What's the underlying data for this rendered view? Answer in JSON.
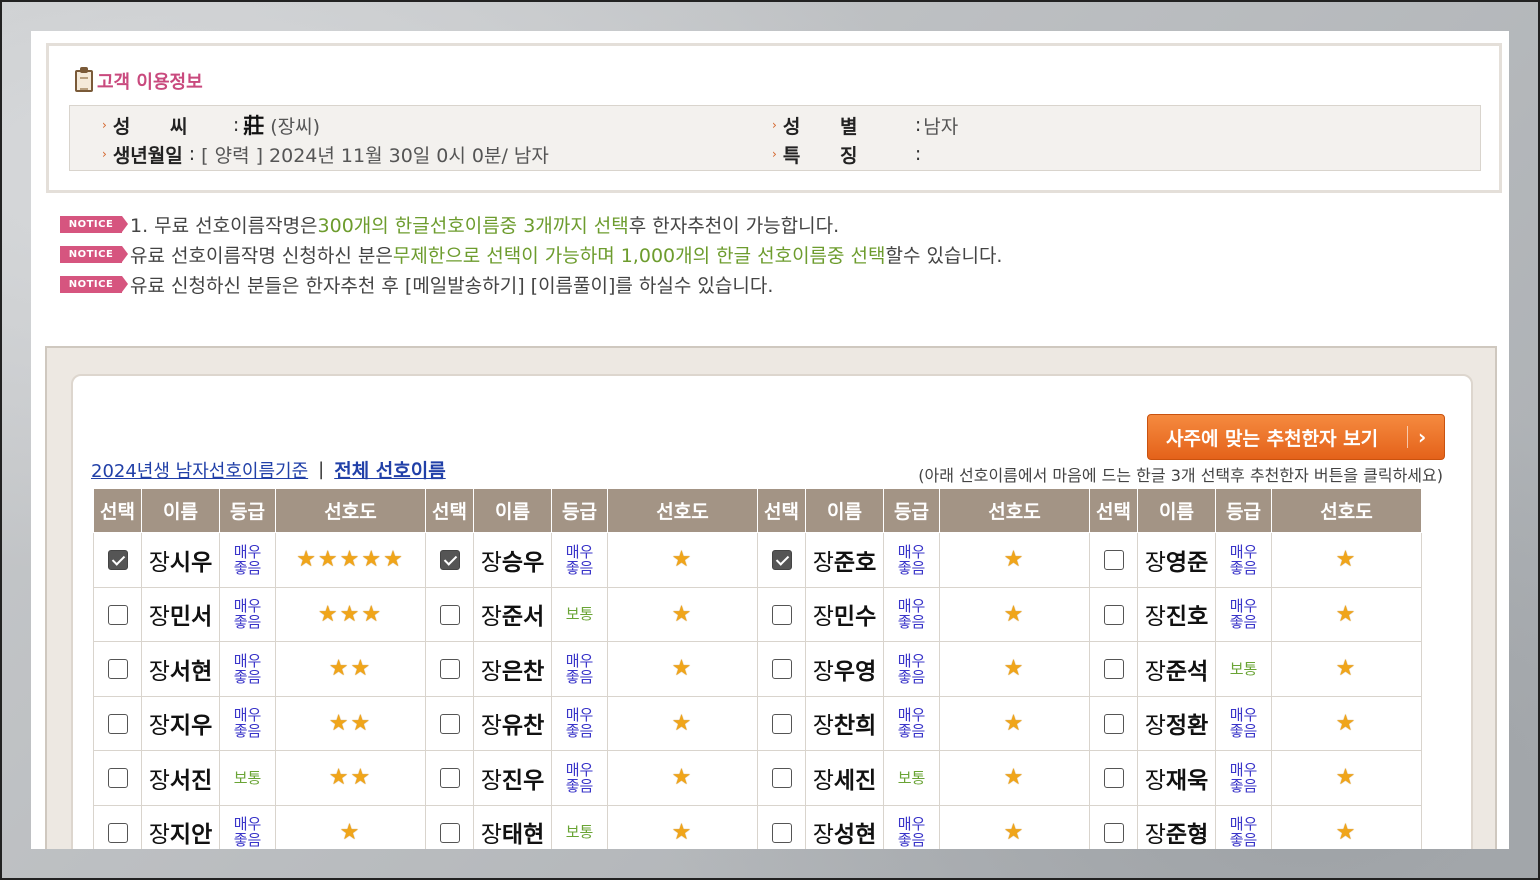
{
  "customer": {
    "title": "고객 이용정보",
    "surname_label": "성      씨",
    "surname_hanja": "莊",
    "surname_reading": "(장씨)",
    "gender_label": "성      별",
    "gender_value": "남자",
    "birth_label": "생년월일",
    "birth_value": "[ 양력 ] 2024년 11월 30일 0시 0분/ 남자",
    "feature_label": "특      징",
    "feature_value": ""
  },
  "notices": [
    {
      "badge": "NOTICE",
      "parts": [
        {
          "text": "1. 무료 선호이름작명은 ",
          "hl": false
        },
        {
          "text": "300개의 한글선호이름중 3개까지 선택",
          "hl": true
        },
        {
          "text": "후 한자추천이 가능합니다.",
          "hl": false
        }
      ]
    },
    {
      "badge": "NOTICE",
      "parts": [
        {
          "text": "유료 선호이름작명 신청하신 분은",
          "hl": false
        },
        {
          "text": "무제한으로 선택이 가능하며 1,000개의 한글 선호이름중 선택",
          "hl": true
        },
        {
          "text": "할수 있습니다.",
          "hl": false
        }
      ]
    },
    {
      "badge": "NOTICE",
      "parts": [
        {
          "text": "유료 신청하신 분들은 한자추천 후 [메일발송하기] [이름풀이]를 하실수 있습니다.",
          "hl": false
        }
      ]
    }
  ],
  "panel": {
    "recommend_button": "사주에 맞는 추천한자 보기",
    "recommend_arrow": "›",
    "link_basis": "2024년생 남자선호이름기준",
    "link_separator": "|",
    "link_all": "전체 선호이름",
    "hint": "(아래 선호이름에서 마음에 드는 한글 3개 선택후 추천한자 버튼을 클릭하세요)"
  },
  "table": {
    "headers": [
      "선택",
      "이름",
      "등급",
      "선호도"
    ],
    "rows": [
      [
        {
          "checked": true,
          "surname": "장",
          "given": "시우",
          "grade": "매우좋음",
          "stars": 5
        },
        {
          "checked": true,
          "surname": "장",
          "given": "승우",
          "grade": "매우좋음",
          "stars": 1
        },
        {
          "checked": true,
          "surname": "장",
          "given": "준호",
          "grade": "매우좋음",
          "stars": 1
        },
        {
          "checked": false,
          "surname": "장",
          "given": "영준",
          "grade": "매우좋음",
          "stars": 1
        }
      ],
      [
        {
          "checked": false,
          "surname": "장",
          "given": "민서",
          "grade": "매우좋음",
          "stars": 3
        },
        {
          "checked": false,
          "surname": "장",
          "given": "준서",
          "grade": "보통",
          "stars": 1
        },
        {
          "checked": false,
          "surname": "장",
          "given": "민수",
          "grade": "매우좋음",
          "stars": 1
        },
        {
          "checked": false,
          "surname": "장",
          "given": "진호",
          "grade": "매우좋음",
          "stars": 1
        }
      ],
      [
        {
          "checked": false,
          "surname": "장",
          "given": "서현",
          "grade": "매우좋음",
          "stars": 2
        },
        {
          "checked": false,
          "surname": "장",
          "given": "은찬",
          "grade": "매우좋음",
          "stars": 1
        },
        {
          "checked": false,
          "surname": "장",
          "given": "우영",
          "grade": "매우좋음",
          "stars": 1
        },
        {
          "checked": false,
          "surname": "장",
          "given": "준석",
          "grade": "보통",
          "stars": 1
        }
      ],
      [
        {
          "checked": false,
          "surname": "장",
          "given": "지우",
          "grade": "매우좋음",
          "stars": 2
        },
        {
          "checked": false,
          "surname": "장",
          "given": "유찬",
          "grade": "매우좋음",
          "stars": 1
        },
        {
          "checked": false,
          "surname": "장",
          "given": "찬희",
          "grade": "매우좋음",
          "stars": 1
        },
        {
          "checked": false,
          "surname": "장",
          "given": "정환",
          "grade": "매우좋음",
          "stars": 1
        }
      ],
      [
        {
          "checked": false,
          "surname": "장",
          "given": "서진",
          "grade": "보통",
          "stars": 2
        },
        {
          "checked": false,
          "surname": "장",
          "given": "진우",
          "grade": "매우좋음",
          "stars": 1
        },
        {
          "checked": false,
          "surname": "장",
          "given": "세진",
          "grade": "보통",
          "stars": 1
        },
        {
          "checked": false,
          "surname": "장",
          "given": "재욱",
          "grade": "매우좋음",
          "stars": 1
        }
      ],
      [
        {
          "checked": false,
          "surname": "장",
          "given": "지안",
          "grade": "매우좋음",
          "stars": 1
        },
        {
          "checked": false,
          "surname": "장",
          "given": "태현",
          "grade": "보통",
          "stars": 1
        },
        {
          "checked": false,
          "surname": "장",
          "given": "성현",
          "grade": "매우좋음",
          "stars": 1
        },
        {
          "checked": false,
          "surname": "장",
          "given": "준형",
          "grade": "매우좋음",
          "stars": 1
        }
      ]
    ]
  },
  "colors": {
    "header_bg": "#a39485",
    "grade_good": "#3a35c9",
    "grade_normal": "#6aa435",
    "star": "#f0a51a",
    "button": "#e4621a",
    "notice_badge": "#d6557f",
    "highlight": "#6d9c2e"
  }
}
